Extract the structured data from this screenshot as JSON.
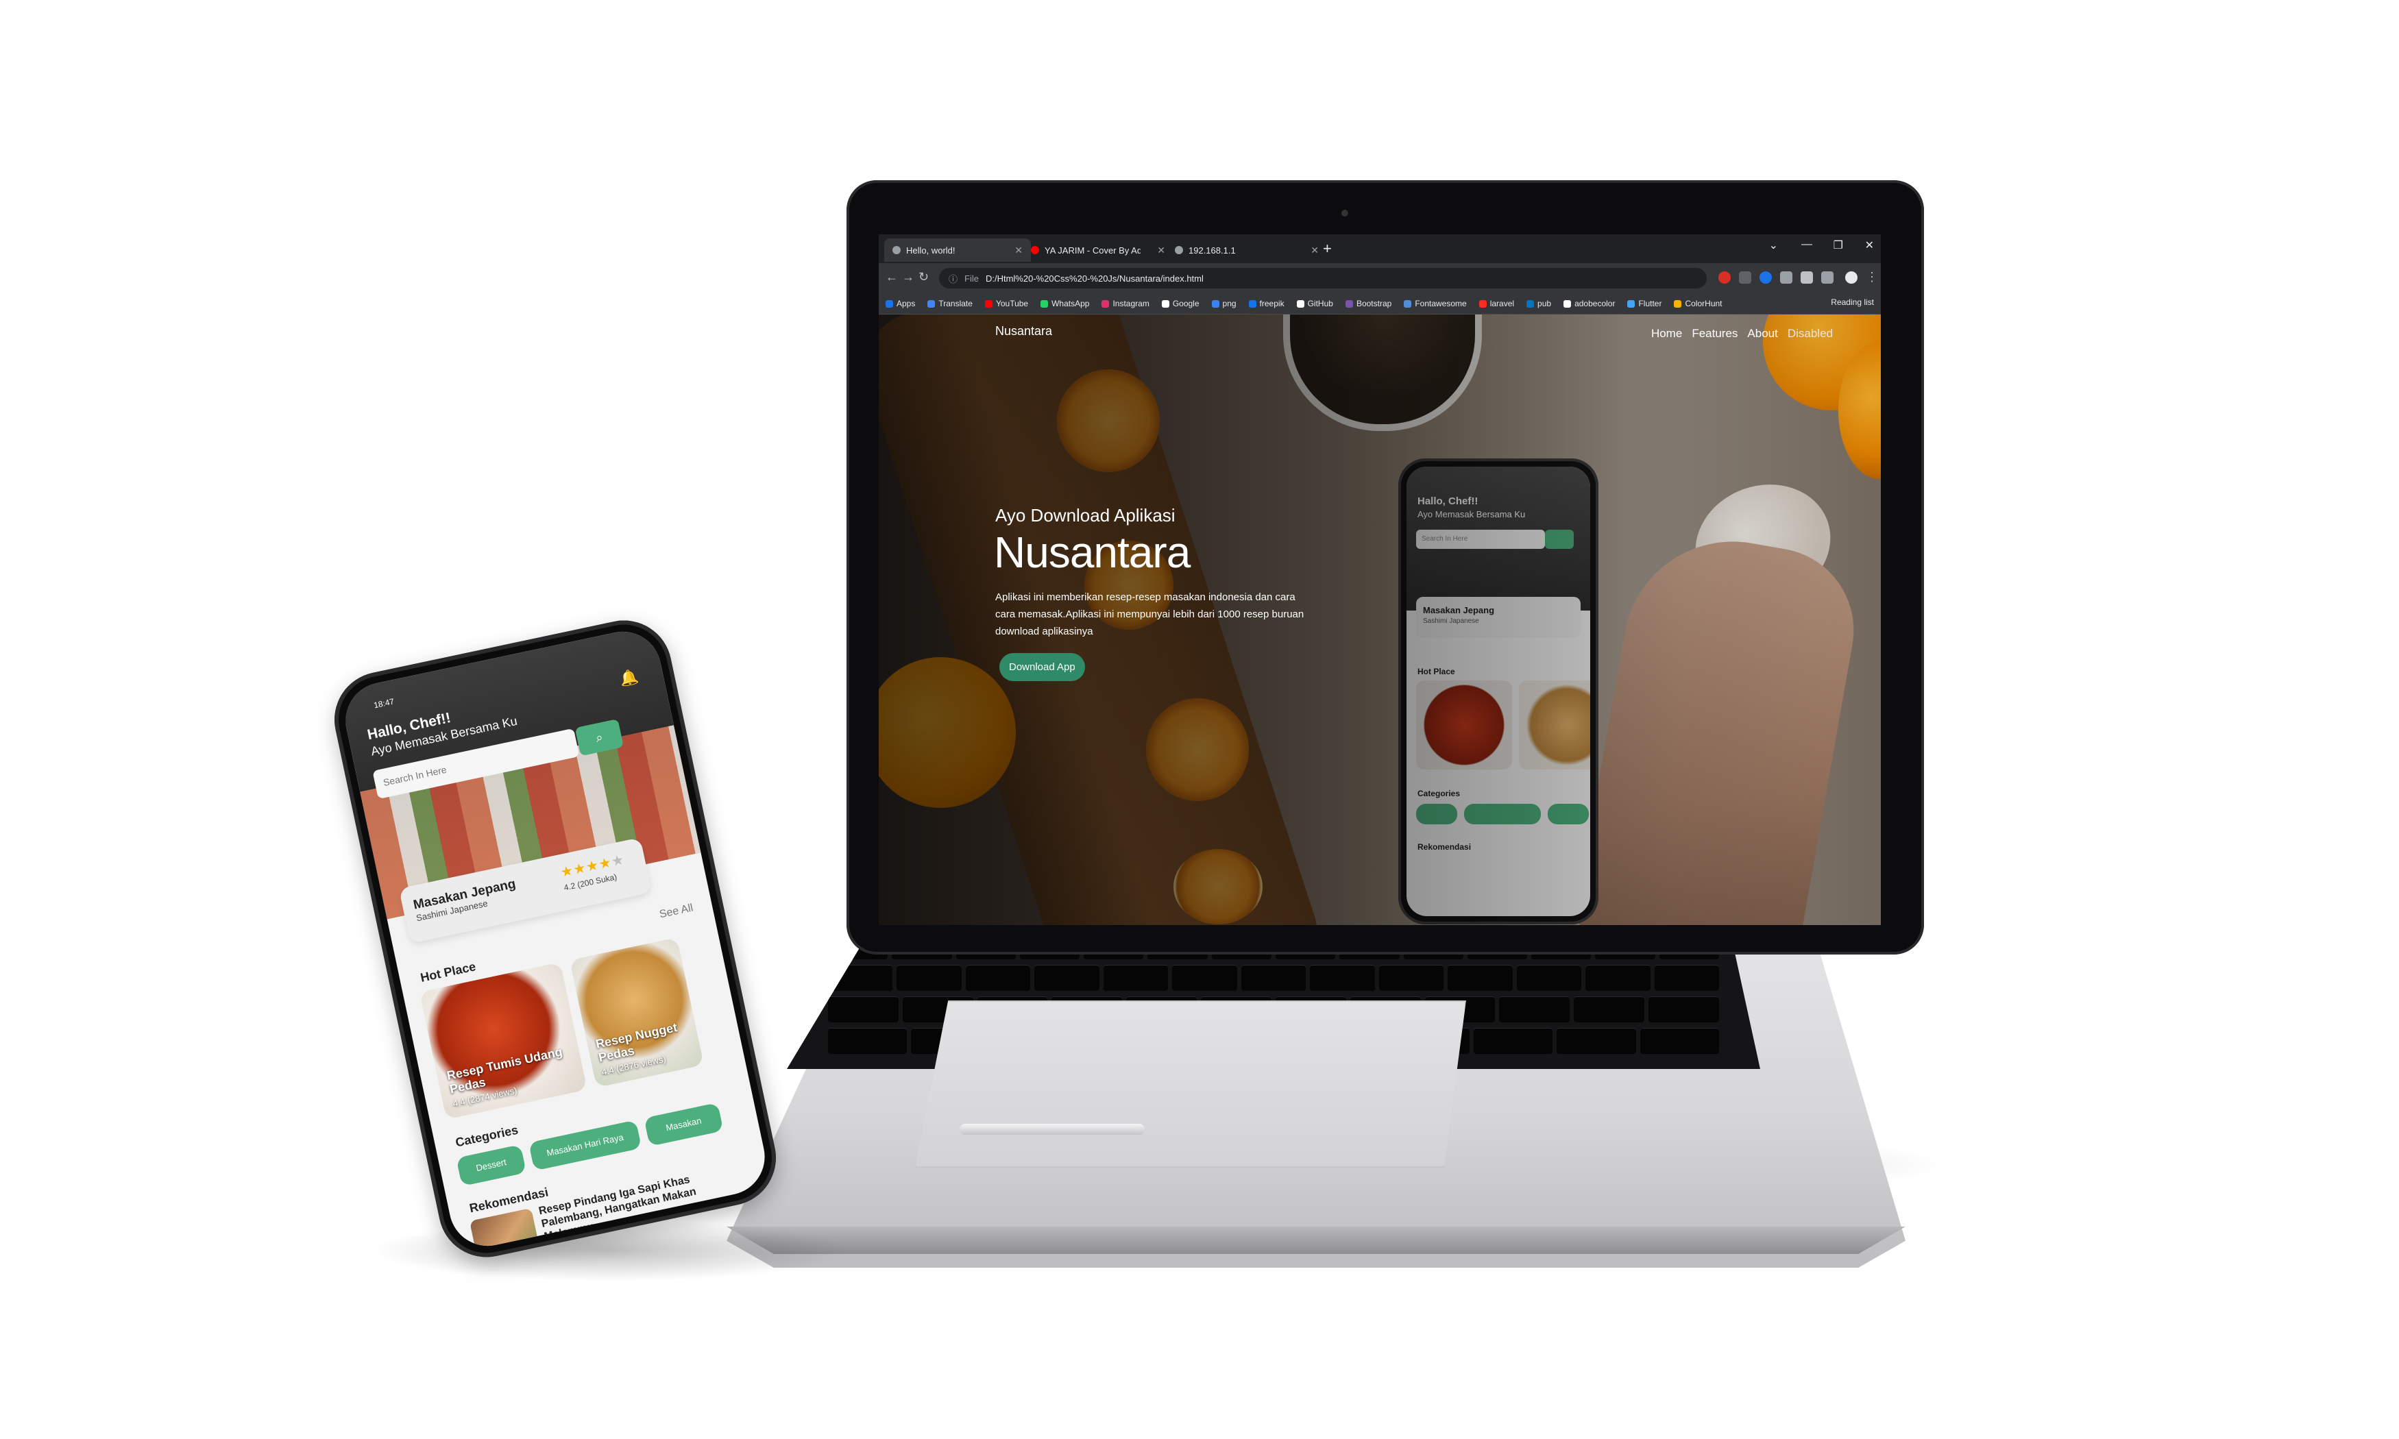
{
  "browser": {
    "tabs": [
      {
        "title": "Hello, world!",
        "active": true
      },
      {
        "title": "YA JARIM - Cover By Adzani",
        "active": false
      },
      {
        "title": "192.168.1.1",
        "active": false
      }
    ],
    "omnibox": {
      "info": "File",
      "url": "D:/Html%20-%20Css%20-%20Js/Nusantara/index.html"
    },
    "bookmarks": [
      "Apps",
      "Translate",
      "YouTube",
      "WhatsApp",
      "Instagram",
      "Google",
      "png",
      "freepik",
      "GitHub",
      "Bootstrap",
      "Fontawesome",
      "laravel",
      "pub",
      "adobecolor",
      "Flutter",
      "ColorHunt"
    ],
    "reading_list": "Reading list"
  },
  "site": {
    "brand": "Nusantara",
    "nav": [
      "Home",
      "Features",
      "About",
      "Disabled"
    ],
    "hero": {
      "subtitle": "Ayo Download Aplikasi",
      "title": "Nusantara",
      "description": "Aplikasi ini memberikan resep-resep masakan indonesia dan cara cara memasak.Aplikasi ini mempunyai lebih dari 1000 resep buruan download aplikasinya",
      "button": "Download App"
    }
  },
  "app": {
    "time": "18:47",
    "greeting": "Hallo, Chef!!",
    "subtitle": "Ayo Memasak Bersama Ku",
    "search_placeholder": "Search In Here",
    "featured": {
      "title": "Masakan Jepang",
      "subtitle": "Sashimi Japanese",
      "rating": 4.2,
      "rating_max": 5,
      "rating_text": "4.2 (200 Suka)"
    },
    "hot_place": {
      "title": "Hot Place",
      "see_all": "See All",
      "items": [
        {
          "title": "Resep Tumis Udang Pedas",
          "views": "4.4 (2874 views)"
        },
        {
          "title": "Resep Nugget Pedas",
          "views": "4.4 (2876 views)"
        }
      ]
    },
    "categories": {
      "title": "Categories",
      "items": [
        "Dessert",
        "Masakan Hari Raya",
        "Masakan"
      ]
    },
    "rekomendasi": {
      "title": "Rekomendasi",
      "item": "Resep Pindang Iga Sapi Khas Palembang, Hangatkan Makan Malammu"
    }
  },
  "colors": {
    "accent": "#4caf7d",
    "hero_button": "#2f8a67",
    "stars": "#f5b400"
  }
}
